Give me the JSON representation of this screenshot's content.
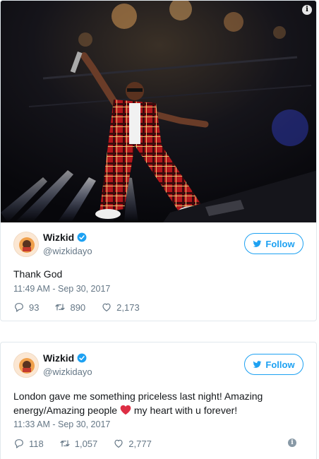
{
  "tweets": [
    {
      "display_name": "Wizkid",
      "handle": "@wizkidayo",
      "follow_label": "Follow",
      "text": "Thank God",
      "timestamp": "11:49 AM - Sep 30, 2017",
      "replies": "93",
      "retweets": "890",
      "likes": "2,173",
      "has_photo": true
    },
    {
      "display_name": "Wizkid",
      "handle": "@wizkidayo",
      "follow_label": "Follow",
      "text_before_emoji": "London gave me something priceless last night! Amazing energy/Amazing people ",
      "emoji": "red-heart-emoji",
      "text_after_emoji": " my heart with u forever!",
      "timestamp": "11:33 AM - Sep 30, 2017",
      "replies": "118",
      "retweets": "1,057",
      "likes": "2,777"
    }
  ],
  "colors": {
    "twitter_blue": "#1da1f2",
    "text": "#14171a",
    "secondary": "#657786",
    "border": "#e1e8ed",
    "heart_red": "#dd2e44"
  }
}
